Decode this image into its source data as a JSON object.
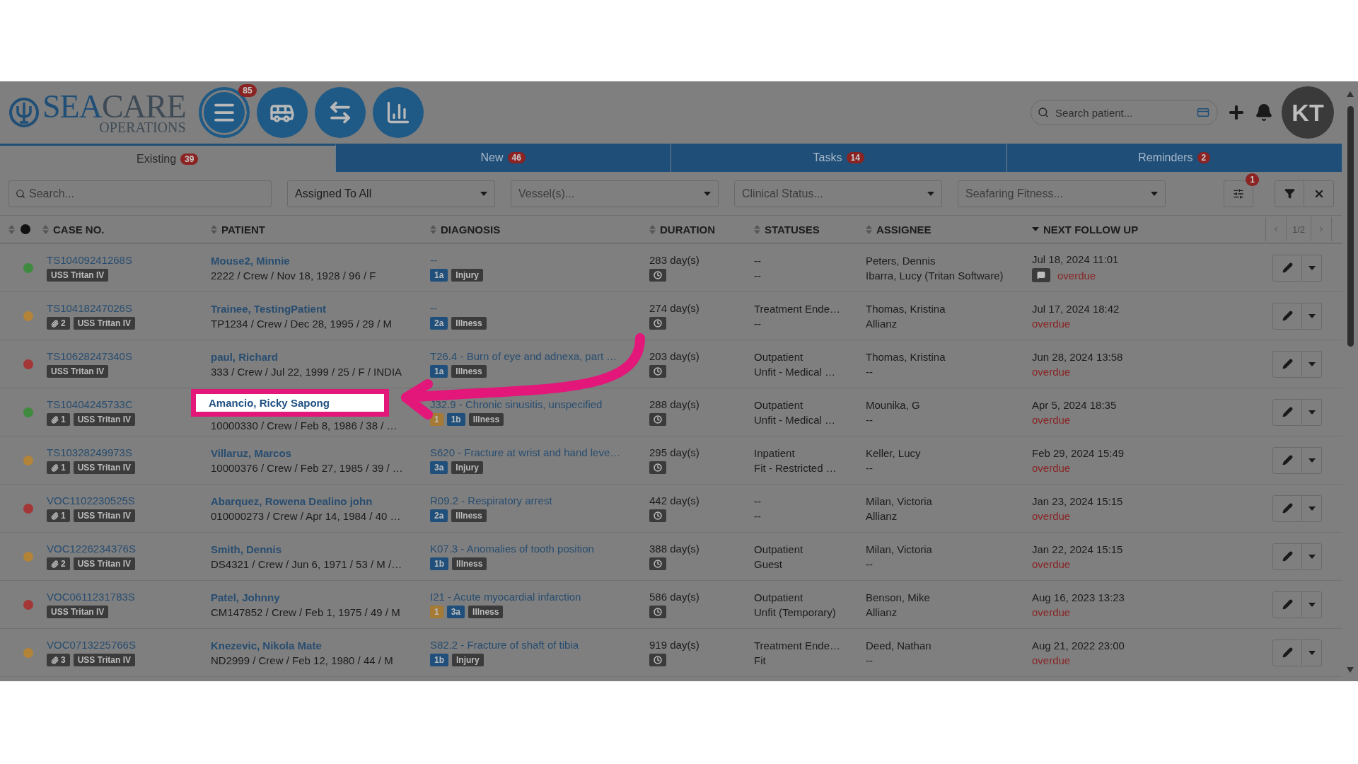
{
  "header": {
    "logo": {
      "name_start": "SEA",
      "name_end": "CARE",
      "subtitle": "OPERATIONS"
    },
    "nav_buttons": [
      {
        "kind": "menu",
        "badge": "85"
      },
      {
        "kind": "bus"
      },
      {
        "kind": "transfer"
      },
      {
        "kind": "chart"
      }
    ],
    "search": {
      "placeholder": "Search patient..."
    },
    "avatar": "KT"
  },
  "tabs": [
    {
      "label": "Existing",
      "count": "39",
      "selected": true
    },
    {
      "label": "New",
      "count": "46",
      "selected": false
    },
    {
      "label": "Tasks",
      "count": "14",
      "selected": false
    },
    {
      "label": "Reminders",
      "count": "2",
      "selected": false
    }
  ],
  "filters": {
    "search": {
      "placeholder": "Search..."
    },
    "selects": [
      {
        "value": "Assigned To All"
      },
      {
        "placeholder": "Vessel(s)..."
      },
      {
        "placeholder": "Clinical Status..."
      },
      {
        "placeholder": "Seafaring Fitness..."
      }
    ],
    "settings_badge": "1"
  },
  "table": {
    "columns": [
      {
        "label": "CASE NO.",
        "sorted": false
      },
      {
        "label": "PATIENT",
        "sorted": false
      },
      {
        "label": "DIAGNOSIS",
        "sorted": false
      },
      {
        "label": "DURATION",
        "sorted": false
      },
      {
        "label": "STATUSES",
        "sorted": false
      },
      {
        "label": "ASSIGNEE",
        "sorted": false
      },
      {
        "label": "NEXT FOLLOW UP",
        "sorted": true
      }
    ],
    "pager": "1/2",
    "rows": [
      {
        "color": "#3e8a3e",
        "case_no": "TS10409241268S",
        "vessel": "USS Tritan IV",
        "patient": "Mouse2, Minnie",
        "details": "2222 / Crew / Nov 18, 1928 / 96 / F",
        "highlighted": false,
        "diagnosis": "--",
        "tags": [
          {
            "kind": "level",
            "label": "1a"
          },
          {
            "kind": "type",
            "label": "Injury"
          }
        ],
        "duration": "283 day(s)",
        "statuses": [
          "--",
          "--"
        ],
        "assignees": [
          "Peters, Dennis",
          "Ibarra, Lucy (Tritan Software)"
        ],
        "follow_up": "Jul 18, 2024 11:01",
        "has_comment": true,
        "overdue": "overdue"
      },
      {
        "color": "#b38338",
        "case_no": "TS10418247026S",
        "attachments": "2",
        "vessel": "USS Tritan IV",
        "patient": "Trainee, TestingPatient",
        "details": "TP1234 / Crew / Dec 28, 1995 / 29 / M",
        "highlighted": false,
        "diagnosis": "--",
        "tags": [
          {
            "kind": "level",
            "label": "2a"
          },
          {
            "kind": "type",
            "label": "Illness"
          }
        ],
        "duration": "274 day(s)",
        "statuses": [
          "Treatment Ende…",
          "--"
        ],
        "assignees": [
          "Thomas, Kristina",
          "Allianz"
        ],
        "follow_up": "Jul 17, 2024 18:42",
        "has_comment": false,
        "overdue": "overdue"
      },
      {
        "color": "#a33636",
        "case_no": "TS10628247340S",
        "vessel": "USS Tritan IV",
        "patient": "paul, Richard",
        "details": "333 / Crew / Jul 22, 1999 / 25 / F / INDIA",
        "highlighted": false,
        "diagnosis": "T26.4 - Burn of eye and adnexa, part …",
        "tags": [
          {
            "kind": "level",
            "label": "1a"
          },
          {
            "kind": "type",
            "label": "Illness"
          }
        ],
        "duration": "203 day(s)",
        "statuses": [
          "Outpatient",
          "Unfit - Medical …"
        ],
        "assignees": [
          "Thomas, Kristina",
          "--"
        ],
        "follow_up": "Jun 28, 2024 13:58",
        "has_comment": false,
        "overdue": "overdue"
      },
      {
        "color": "#3e8a3e",
        "case_no": "TS10404245733C",
        "attachments": "1",
        "vessel": "USS Tritan IV",
        "patient": "Amancio, Ricky Sapong",
        "details": "10000330 / Crew / Feb 8, 1986 / 38 / …",
        "highlighted": true,
        "diagnosis": "J32.9 - Chronic sinusitis, unspecified",
        "tags": [
          {
            "kind": "priority",
            "label": "1"
          },
          {
            "kind": "level",
            "label": "1b"
          },
          {
            "kind": "type",
            "label": "Illness"
          }
        ],
        "duration": "288 day(s)",
        "statuses": [
          "Outpatient",
          "Unfit - Medical …"
        ],
        "assignees": [
          "Mounika, G",
          "--"
        ],
        "follow_up": "Apr 5, 2024 18:35",
        "has_comment": false,
        "overdue": "overdue"
      },
      {
        "color": "#b38338",
        "case_no": "TS10328249973S",
        "attachments": "1",
        "vessel": "USS Tritan IV",
        "patient": "Villaruz, Marcos",
        "details": "10000376 / Crew / Feb 27, 1985 / 39 / …",
        "highlighted": false,
        "diagnosis": "S620 - Fracture at wrist and hand leve…",
        "tags": [
          {
            "kind": "level",
            "label": "3a"
          },
          {
            "kind": "type",
            "label": "Injury"
          }
        ],
        "duration": "295 day(s)",
        "statuses": [
          "Inpatient",
          "Fit - Restricted …"
        ],
        "assignees": [
          "Keller, Lucy",
          "--"
        ],
        "follow_up": "Feb 29, 2024 15:49",
        "has_comment": false,
        "overdue": "overdue"
      },
      {
        "color": "#a33636",
        "case_no": "VOC1102230525S",
        "attachments": "1",
        "vessel": "USS Tritan IV",
        "patient": "Abarquez, Rowena Dealino john",
        "details": "010000273 / Crew / Apr 14, 1984 / 40 …",
        "highlighted": false,
        "diagnosis": "R09.2 - Respiratory arrest",
        "tags": [
          {
            "kind": "level",
            "label": "2a"
          },
          {
            "kind": "type",
            "label": "Illness"
          }
        ],
        "duration": "442 day(s)",
        "statuses": [
          "--",
          "--"
        ],
        "assignees": [
          "Milan, Victoria",
          "Allianz"
        ],
        "follow_up": "Jan 23, 2024 15:15",
        "has_comment": false,
        "overdue": "overdue"
      },
      {
        "color": "#b38338",
        "case_no": "VOC1226234376S",
        "attachments": "2",
        "vessel": "USS Tritan IV",
        "patient": "Smith, Dennis",
        "details": "DS4321 / Crew / Jun 6, 1971 / 53 / M /…",
        "highlighted": false,
        "diagnosis": "K07.3 - Anomalies of tooth position",
        "tags": [
          {
            "kind": "level",
            "label": "1b"
          },
          {
            "kind": "type",
            "label": "Illness"
          }
        ],
        "duration": "388 day(s)",
        "statuses": [
          "Outpatient",
          "Guest"
        ],
        "assignees": [
          "Milan, Victoria",
          "--"
        ],
        "follow_up": "Jan 22, 2024 15:15",
        "has_comment": false,
        "overdue": "overdue"
      },
      {
        "color": "#a33636",
        "case_no": "VOC0611231783S",
        "vessel": "USS Tritan IV",
        "patient": "Patel, Johnny",
        "details": "CM147852 / Crew / Feb 1, 1975 / 49 / M",
        "highlighted": false,
        "diagnosis": "I21 - Acute myocardial infarction",
        "tags": [
          {
            "kind": "priority",
            "label": "1"
          },
          {
            "kind": "level",
            "label": "3a"
          },
          {
            "kind": "type",
            "label": "Illness"
          }
        ],
        "duration": "586 day(s)",
        "statuses": [
          "Outpatient",
          "Unfit (Temporary)"
        ],
        "assignees": [
          "Benson, Mike",
          "Allianz"
        ],
        "follow_up": "Aug 16, 2023 13:23",
        "has_comment": false,
        "overdue": "overdue"
      },
      {
        "color": "#b38338",
        "case_no": "VOC0713225766S",
        "attachments": "3",
        "vessel": "USS Tritan IV",
        "patient": "Knezevic, Nikola Mate",
        "details": "ND2999 / Crew / Feb 12, 1980 / 44 / M",
        "highlighted": false,
        "diagnosis": "S82.2 - Fracture of shaft of tibia",
        "tags": [
          {
            "kind": "level",
            "label": "1b"
          },
          {
            "kind": "type",
            "label": "Injury"
          }
        ],
        "duration": "919 day(s)",
        "statuses": [
          "Treatment Ende…",
          "Fit"
        ],
        "assignees": [
          "Deed, Nathan",
          "--"
        ],
        "follow_up": "Aug 21, 2022 23:00",
        "has_comment": false,
        "overdue": "overdue"
      }
    ]
  }
}
